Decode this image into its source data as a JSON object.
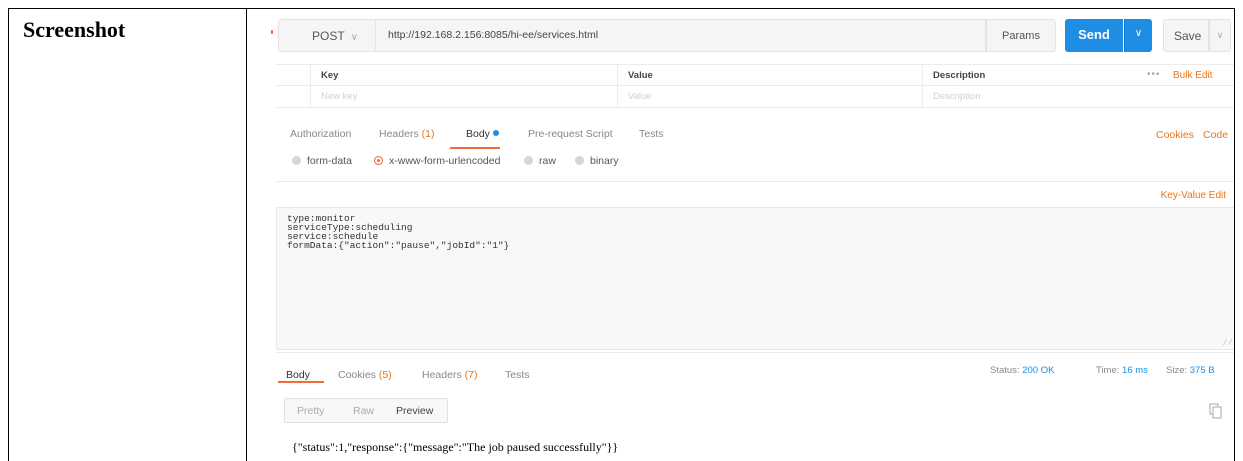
{
  "cell_label": "Screenshot",
  "request": {
    "method": "POST",
    "url": "http://192.168.2.156:8085/hi-ee/services.html",
    "params_label": "Params",
    "send_label": "Send",
    "save_label": "Save"
  },
  "params_table": {
    "headers": [
      "Key",
      "Value",
      "Description"
    ],
    "placeholders": [
      "New key",
      "Value",
      "Description"
    ],
    "bulk_edit": "Bulk Edit",
    "more": "•••"
  },
  "request_tabs": {
    "authorization": "Authorization",
    "headers": "Headers",
    "headers_count": "(1)",
    "body": "Body",
    "pre_request": "Pre-request Script",
    "tests": "Tests",
    "cookies": "Cookies",
    "code": "Code",
    "active": "Body"
  },
  "body_types": {
    "form_data": "form-data",
    "urlencoded": "x-www-form-urlencoded",
    "raw": "raw",
    "binary": "binary",
    "selected": "x-www-form-urlencoded"
  },
  "key_value_edit": "Key-Value Edit",
  "editor_lines": [
    "type:monitor",
    "serviceType:scheduling",
    "service:schedule",
    "formData:{\"action\":\"pause\",\"jobId\":\"1\"}"
  ],
  "response_tabs": {
    "body": "Body",
    "cookies": "Cookies",
    "cookies_count": "(5)",
    "headers": "Headers",
    "headers_count": "(7)",
    "tests": "Tests"
  },
  "status": {
    "status_label": "Status:",
    "status_value": "200 OK",
    "time_label": "Time:",
    "time_value": "16 ms",
    "size_label": "Size:",
    "size_value": "375 B"
  },
  "view_modes": {
    "pretty": "Pretty",
    "raw": "Raw",
    "preview": "Preview",
    "active": "Preview"
  },
  "response_body": "{\"status\":1,\"response\":{\"message\":\"The job paused successfully\"}}",
  "colors": {
    "accent_orange": "#f26b3a",
    "send_blue": "#1e8ee4",
    "link_orange": "#e8761a"
  }
}
